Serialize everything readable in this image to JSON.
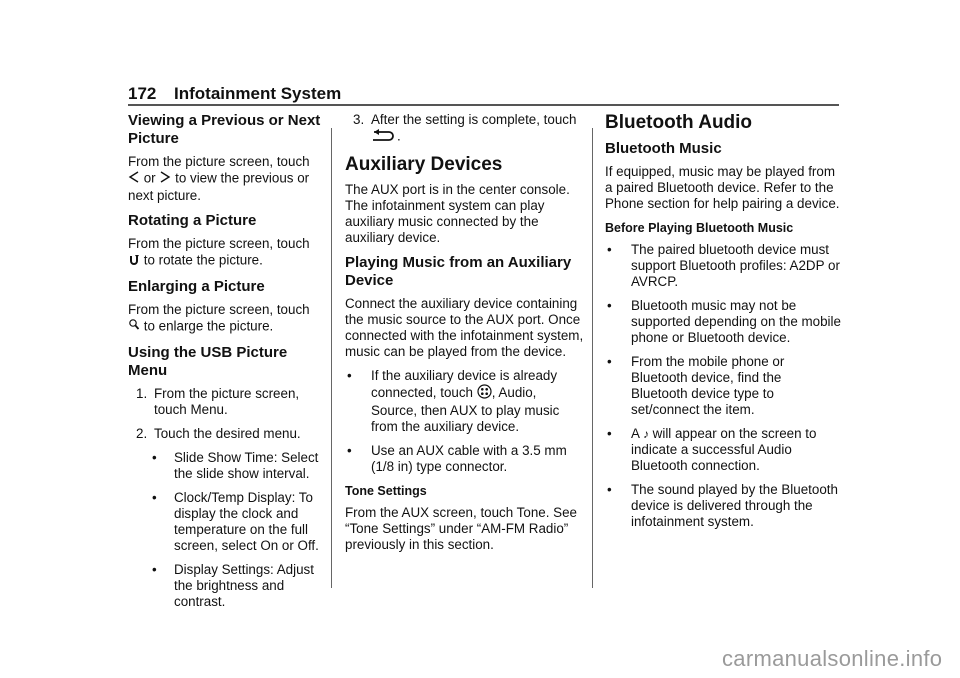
{
  "header": {
    "page_number": "172",
    "section_title": "Infotainment System"
  },
  "col1": {
    "s1_title": "Viewing a Previous or Next Picture",
    "s1_text_a": "From the picture screen, touch",
    "s1_text_b": "or",
    "s1_text_c": "to view the previous or next picture.",
    "s1_icon1": "chevron-left-icon",
    "s1_icon2": "chevron-right-icon",
    "s2_title": "Rotating a Picture",
    "s2_text_a": "From the picture screen, touch",
    "s2_text_b": "to rotate the picture.",
    "s3_title": "Enlarging a Picture",
    "s3_text_a": "From the picture screen, touch",
    "s3_text_b": "to enlarge the picture.",
    "s4_title": "Using the USB Picture Menu",
    "steps": [
      {
        "n": "1.",
        "text": "From the picture screen, touch Menu."
      },
      {
        "n": "2.",
        "text": "Touch the desired menu."
      }
    ],
    "bullets": [
      "Slide Show Time: Select the slide show interval.",
      "Clock/Temp Display: To display the clock and temperature on the full screen, select On or Off.",
      "Display Settings: Adjust the brightness and contrast."
    ],
    "bullet_char": "•"
  },
  "col2": {
    "step3_n": "3.",
    "step3_text_a": "After the setting is complete, touch",
    "step3_text_b": ".",
    "aux_title": "Auxiliary Devices",
    "aux_text": "The AUX port is in the center console. The infotainment system can play auxiliary music connected by the auxiliary device.",
    "play_title": "Playing Music from an Auxiliary Device",
    "play_text": "Connect the auxiliary device containing the music source to the AUX port. Once connected with the infotainment system, music can be played from the device.",
    "b1_a": "If the auxiliary device is already connected, touch",
    "b1_b": ", Audio, Source, then AUX to play music from the auxiliary device.",
    "b2": "Use an AUX cable with a 3.5 mm (1/8 in) type connector.",
    "tone_title": "Tone Settings",
    "tone_text": "From the AUX screen, touch Tone. See “Tone Settings” under “AM-FM Radio” previously in this section."
  },
  "col3": {
    "bt_title": "Bluetooth Audio",
    "btm_title": "Bluetooth Music",
    "btm_text": "If equipped, music may be played from a paired Bluetooth device. Refer to the Phone section for help pairing a device.",
    "before_title": "Before Playing Bluetooth Music",
    "b1": "The paired bluetooth device must support Bluetooth profiles: A2DP or AVRCP.",
    "b2": "Bluetooth music may not be supported depending on the mobile phone or Bluetooth device.",
    "b3": "From the mobile phone or Bluetooth device, find the Bluetooth device type to set/connect the item.",
    "b4_a": "A",
    "b4_note": "♪",
    "b4_b": "will appear on the screen to indicate a successful Audio Bluetooth connection.",
    "b5": "The sound played by the Bluetooth device is delivered through the infotainment system."
  },
  "watermark": "carmanualsonline.info"
}
